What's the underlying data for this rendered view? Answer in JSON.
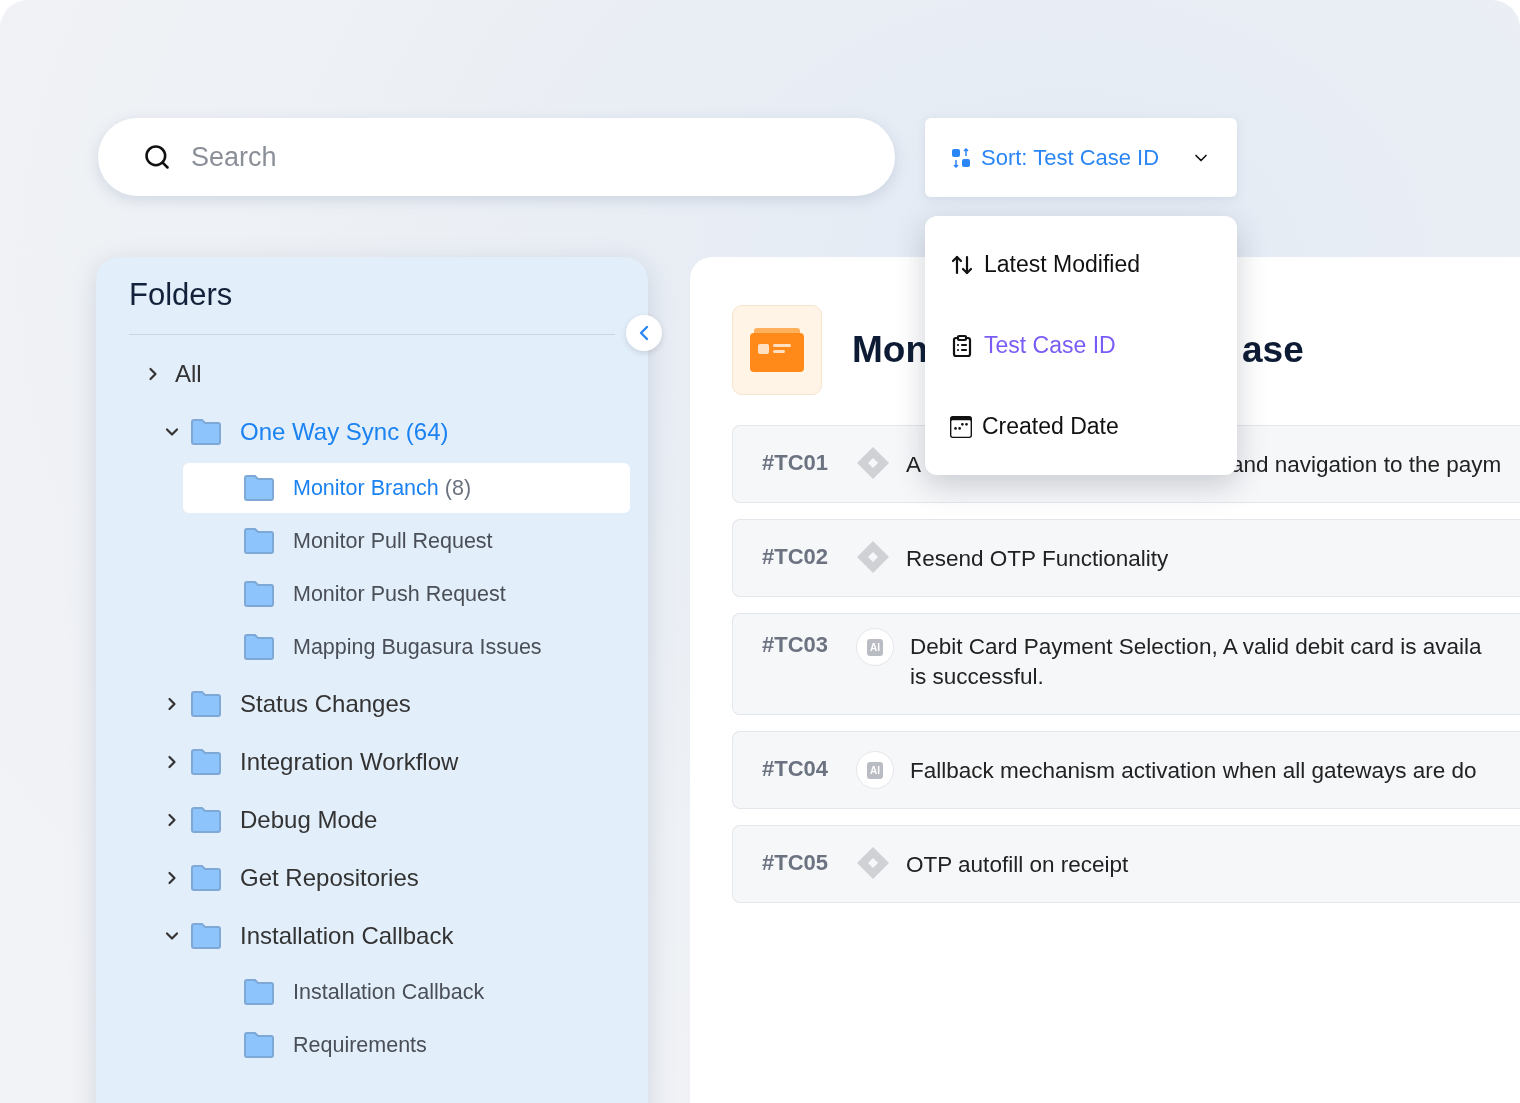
{
  "search": {
    "placeholder": "Search"
  },
  "sort": {
    "label": "Sort: Test Case ID",
    "options": [
      {
        "label": "Latest Modified",
        "selected": false
      },
      {
        "label": "Test Case ID",
        "selected": true
      },
      {
        "label": "Created Date",
        "selected": false
      }
    ]
  },
  "sidebar": {
    "title": "Folders",
    "items": [
      {
        "label": "All",
        "kind": "root",
        "expanded": false,
        "selected": false
      },
      {
        "label": "One Way Sync (64)",
        "kind": "folder",
        "expanded": true,
        "selected": false,
        "children": [
          {
            "label": "Monitor Branch",
            "count": "(8)",
            "selected": true
          },
          {
            "label": "Monitor Pull Request",
            "selected": false
          },
          {
            "label": "Monitor Push Request",
            "selected": false
          },
          {
            "label": "Mapping Bugasura Issues",
            "selected": false
          }
        ]
      },
      {
        "label": "Status Changes",
        "kind": "folder",
        "expanded": false,
        "selected": false
      },
      {
        "label": "Integration Workflow",
        "kind": "folder",
        "expanded": false,
        "selected": false
      },
      {
        "label": "Debug Mode",
        "kind": "folder",
        "expanded": false,
        "selected": false
      },
      {
        "label": "Get Repositories",
        "kind": "folder",
        "expanded": false,
        "selected": false
      },
      {
        "label": "Installation Callback",
        "kind": "folder",
        "expanded": true,
        "selected": false,
        "children": [
          {
            "label": "Installation Callback",
            "selected": false
          },
          {
            "label": "Requirements",
            "selected": false
          }
        ]
      }
    ]
  },
  "main": {
    "title_parts": [
      "Mon",
      "ase"
    ],
    "rows": [
      {
        "id": "#TC01",
        "kind": "diamond",
        "lines": [
          [
            "A",
            "and navigation to the paym"
          ]
        ]
      },
      {
        "id": "#TC02",
        "kind": "diamond",
        "lines": [
          [
            "Resend OTP Functionality"
          ]
        ]
      },
      {
        "id": "#TC03",
        "kind": "ai",
        "badge": "AI",
        "lines": [
          [
            "Debit Card Payment Selection, A valid debit card is availa"
          ],
          [
            "is successful."
          ]
        ]
      },
      {
        "id": "#TC04",
        "kind": "ai",
        "badge": "AI",
        "lines": [
          [
            "Fallback mechanism activation when all gateways are do"
          ]
        ]
      },
      {
        "id": "#TC05",
        "kind": "diamond",
        "lines": [
          [
            "OTP autofill on receipt"
          ]
        ]
      }
    ]
  }
}
